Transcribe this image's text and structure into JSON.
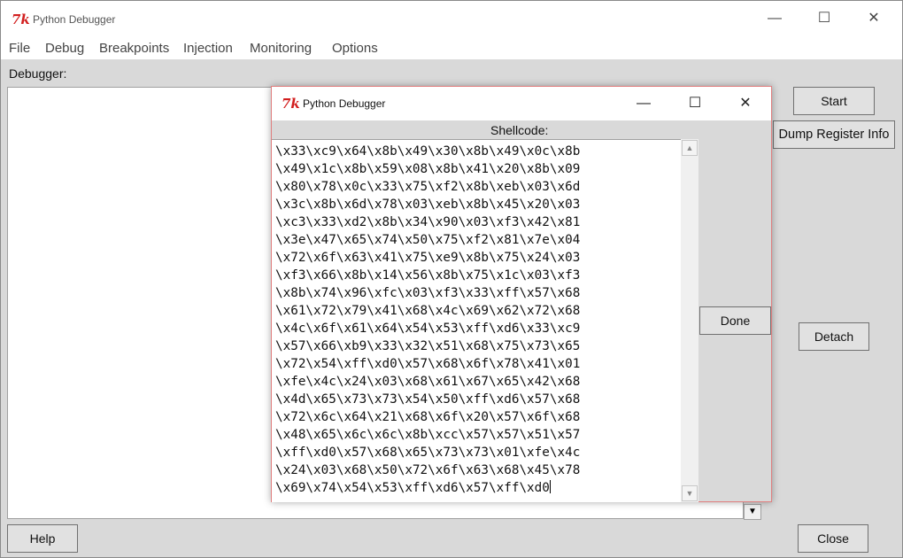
{
  "main_window": {
    "title": "Python Debugger",
    "app_icon": "tk-feather-icon",
    "window_controls": {
      "minimize": "—",
      "maximize": "☐",
      "close": "✕"
    },
    "menu": [
      "File",
      "Debug",
      "Breakpoints",
      "Injection",
      "Monitoring",
      "Options"
    ],
    "debugger_label": "Debugger:",
    "buttons": {
      "start": "Start",
      "dump_register_info": "Dump Register Info",
      "detach": "Detach",
      "help": "Help",
      "close": "Close"
    },
    "scroll_arrow": "▼"
  },
  "dialog": {
    "title": "Python Debugger",
    "app_icon": "tk-feather-icon",
    "window_controls": {
      "minimize": "—",
      "maximize": "☐",
      "close": "✕"
    },
    "shellcode_label": "Shellcode:",
    "done_button": "Done",
    "scroll_up": "▲",
    "scroll_down": "▼",
    "shellcode_lines": [
      "\\x33\\xc9\\x64\\x8b\\x49\\x30\\x8b\\x49\\x0c\\x8b",
      "\\x49\\x1c\\x8b\\x59\\x08\\x8b\\x41\\x20\\x8b\\x09",
      "\\x80\\x78\\x0c\\x33\\x75\\xf2\\x8b\\xeb\\x03\\x6d",
      "\\x3c\\x8b\\x6d\\x78\\x03\\xeb\\x8b\\x45\\x20\\x03",
      "\\xc3\\x33\\xd2\\x8b\\x34\\x90\\x03\\xf3\\x42\\x81",
      "\\x3e\\x47\\x65\\x74\\x50\\x75\\xf2\\x81\\x7e\\x04",
      "\\x72\\x6f\\x63\\x41\\x75\\xe9\\x8b\\x75\\x24\\x03",
      "\\xf3\\x66\\x8b\\x14\\x56\\x8b\\x75\\x1c\\x03\\xf3",
      "\\x8b\\x74\\x96\\xfc\\x03\\xf3\\x33\\xff\\x57\\x68",
      "\\x61\\x72\\x79\\x41\\x68\\x4c\\x69\\x62\\x72\\x68",
      "\\x4c\\x6f\\x61\\x64\\x54\\x53\\xff\\xd6\\x33\\xc9",
      "\\x57\\x66\\xb9\\x33\\x32\\x51\\x68\\x75\\x73\\x65",
      "\\x72\\x54\\xff\\xd0\\x57\\x68\\x6f\\x78\\x41\\x01",
      "\\xfe\\x4c\\x24\\x03\\x68\\x61\\x67\\x65\\x42\\x68",
      "\\x4d\\x65\\x73\\x73\\x54\\x50\\xff\\xd6\\x57\\x68",
      "\\x72\\x6c\\x64\\x21\\x68\\x6f\\x20\\x57\\x6f\\x68",
      "\\x48\\x65\\x6c\\x6c\\x8b\\xcc\\x57\\x57\\x51\\x57",
      "\\xff\\xd0\\x57\\x68\\x65\\x73\\x73\\x01\\xfe\\x4c",
      "\\x24\\x03\\x68\\x50\\x72\\x6f\\x63\\x68\\x45\\x78",
      "\\x69\\x74\\x54\\x53\\xff\\xd6\\x57\\xff\\xd0"
    ]
  }
}
